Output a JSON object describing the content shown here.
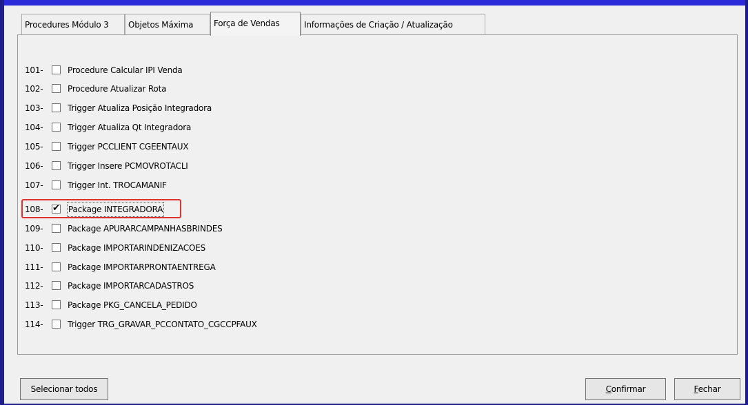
{
  "tabs": [
    {
      "label": "Procedures Módulo 3"
    },
    {
      "label": "Objetos Máxima"
    },
    {
      "label": "Força de Vendas"
    },
    {
      "label": "Informações de Criação / Atualização"
    }
  ],
  "active_tab": "Força de Vendas",
  "items": [
    {
      "num": "101-",
      "label": "Procedure Calcular IPI Venda",
      "checked": false
    },
    {
      "num": "102-",
      "label": "Procedure Atualizar Rota",
      "checked": false
    },
    {
      "num": "103-",
      "label": "Trigger Atualiza Posição Integradora",
      "checked": false
    },
    {
      "num": "104-",
      "label": "Trigger Atualiza Qt Integradora",
      "checked": false
    },
    {
      "num": "105-",
      "label": "Trigger PCCLIENT CGEENTAUX",
      "checked": false
    },
    {
      "num": "106-",
      "label": "Trigger Insere PCMOVROTACLI",
      "checked": false
    },
    {
      "num": "107-",
      "label": "Trigger Int. TROCAMANIF",
      "checked": false
    },
    {
      "num": "108-",
      "label": "Package INTEGRADORA",
      "checked": true
    },
    {
      "num": "109-",
      "label": "Package APURARCAMPANHASBRINDES",
      "checked": false
    },
    {
      "num": "110-",
      "label": "Package IMPORTARINDENIZACOES",
      "checked": false
    },
    {
      "num": "111-",
      "label": "Package IMPORTARPRONTAENTREGA",
      "checked": false
    },
    {
      "num": "112-",
      "label": "Package IMPORTARCADASTROS",
      "checked": false
    },
    {
      "num": "113-",
      "label": "Package PKG_CANCELA_PEDIDO",
      "checked": false
    },
    {
      "num": "114-",
      "label": "Trigger TRG_GRAVAR_PCCONTATO_CGCCPFAUX",
      "checked": false
    }
  ],
  "buttons": {
    "select_all": "Selecionar todos",
    "confirm": "Confirmar",
    "close": "Fechar"
  },
  "colors": {
    "window_border": "#2b2bd9",
    "highlight": "#e03030"
  }
}
